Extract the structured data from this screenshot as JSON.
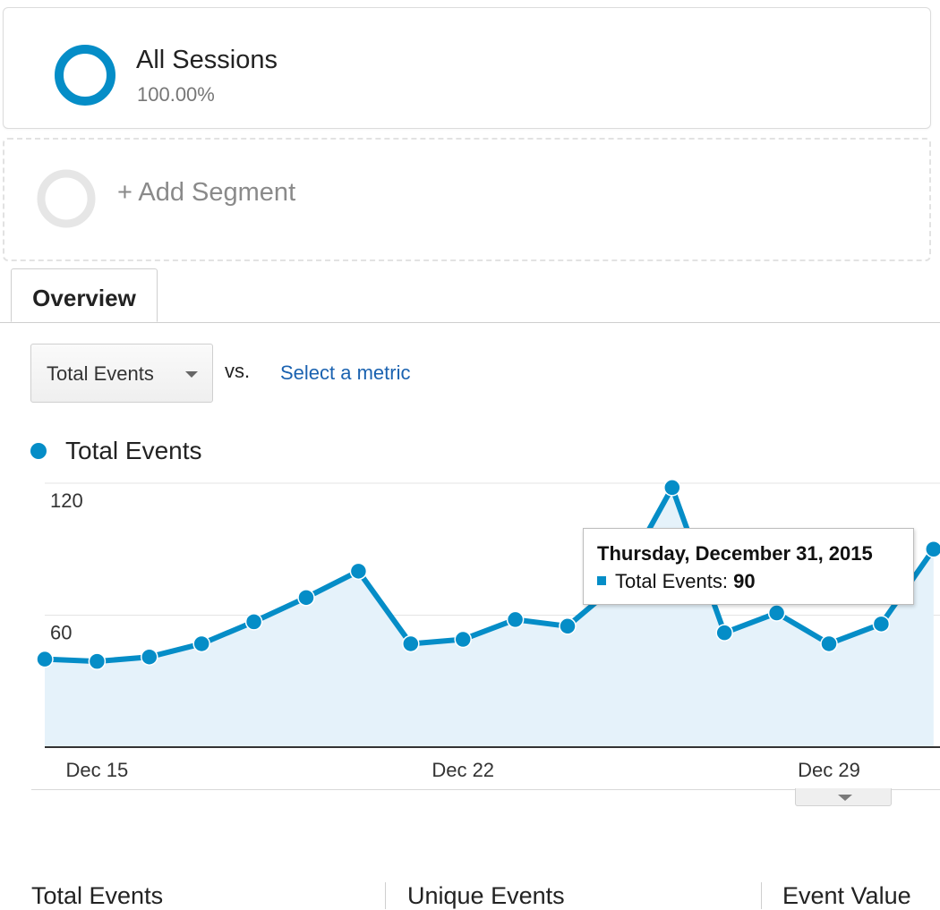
{
  "segments": {
    "active": {
      "name": "All Sessions",
      "percent": "100.00%",
      "ring_color": "#058dc7"
    },
    "add_label": "+ Add Segment"
  },
  "tabs": [
    {
      "label": "Overview"
    }
  ],
  "metric_selector": {
    "selected": "Total Events",
    "vs_label": "vs.",
    "compare_link": "Select a metric"
  },
  "legend": {
    "series_name": "Total Events",
    "color": "#058dc7"
  },
  "tooltip": {
    "date": "Thursday, December 31, 2015",
    "series_label": "Total Events:",
    "value": "90"
  },
  "summary_headers": [
    "Total Events",
    "Unique Events",
    "Event Value"
  ],
  "chart_data": {
    "type": "area",
    "series": [
      {
        "name": "Total Events",
        "color": "#058dc7",
        "x": [
          "Dec 14",
          "Dec 15",
          "Dec 16",
          "Dec 17",
          "Dec 18",
          "Dec 19",
          "Dec 20",
          "Dec 21",
          "Dec 22",
          "Dec 23",
          "Dec 24",
          "Dec 25",
          "Dec 26",
          "Dec 27",
          "Dec 28",
          "Dec 29",
          "Dec 30",
          "Dec 31"
        ],
        "values": [
          40,
          39,
          41,
          47,
          57,
          68,
          80,
          47,
          49,
          58,
          55,
          75,
          118,
          52,
          61,
          47,
          56,
          90
        ]
      }
    ],
    "x_tick_labels": [
      "Dec 15",
      "Dec 22",
      "Dec 29"
    ],
    "y_tick_labels": [
      "120",
      "60"
    ],
    "y_ticks": [
      120,
      60
    ],
    "ylim": [
      0,
      120
    ],
    "grid": true
  }
}
